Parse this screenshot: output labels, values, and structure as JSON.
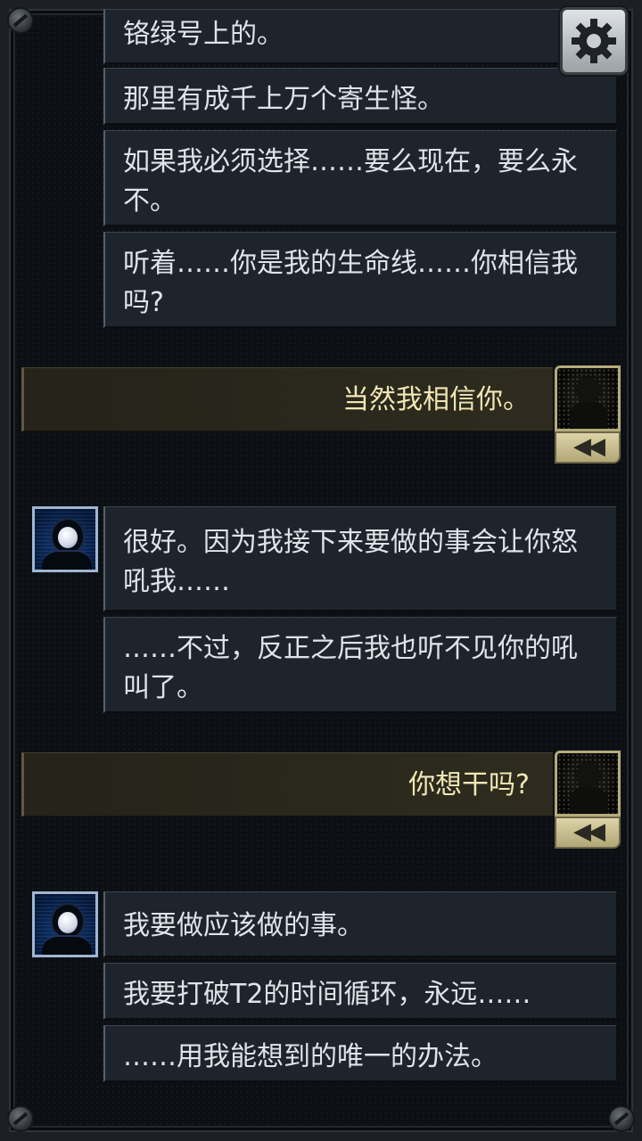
{
  "messages": [
    {
      "id": "m1",
      "text": "铬绿号上的。"
    },
    {
      "id": "m2",
      "text": "那里有成千上万个寄生怪。"
    },
    {
      "id": "m3",
      "text": "如果我必须选择……要么现在，要么永不。"
    },
    {
      "id": "m4",
      "text": "听着……你是我的生命线……你相信我吗?"
    },
    {
      "id": "m5",
      "text": "很好。因为我接下来要做的事会让你怒吼我……"
    },
    {
      "id": "m6",
      "text": "……不过，反正之后我也听不见你的吼叫了。"
    },
    {
      "id": "m7",
      "text": "我要做应该做的事。"
    },
    {
      "id": "m8",
      "text": "我要打破T2的时间循环，永远……"
    },
    {
      "id": "m9",
      "text": "……用我能想到的唯一的办法。"
    }
  ],
  "replies": [
    {
      "id": "r1",
      "text": "当然我相信你。"
    },
    {
      "id": "r2",
      "text": "你想干吗?"
    }
  ],
  "icons": {
    "settings": "gear-icon",
    "rewind": "rewind-icon",
    "player_avatar": "player-portrait",
    "taylor_avatar": "astronaut-portrait"
  },
  "colors": {
    "message_bg": "#1d242c",
    "message_text": "#dfe4e8",
    "reply_text": "#f1e7b4",
    "reply_bg": "#2e2b1e",
    "accent_gold": "#b6aa7a",
    "avatar_blue": "#123b77"
  }
}
